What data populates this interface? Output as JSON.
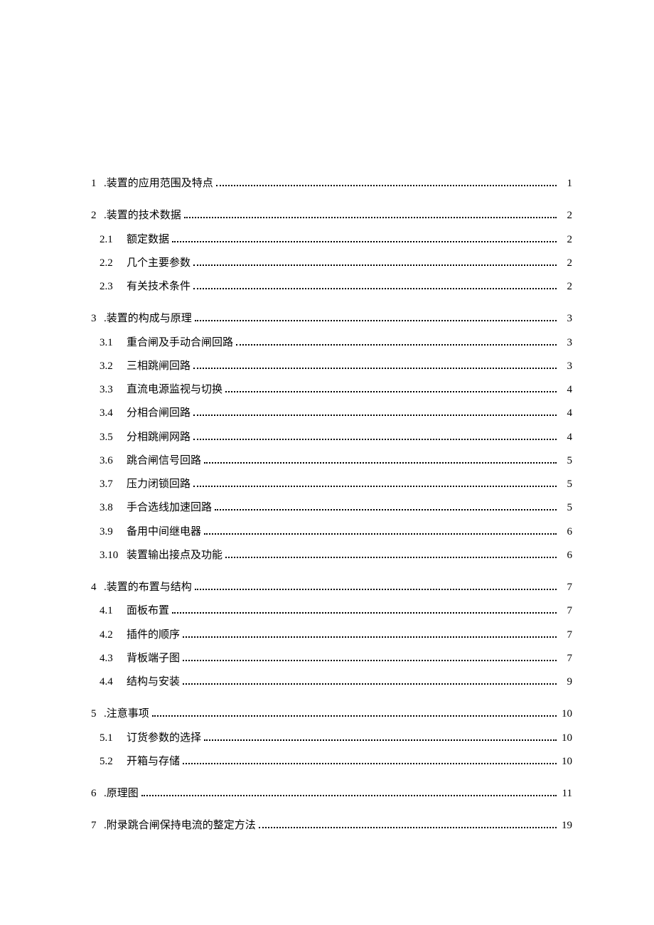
{
  "toc": {
    "sections": [
      {
        "num": "1",
        "title": ".装置的应用范围及特点",
        "page": "1",
        "children": []
      },
      {
        "num": "2",
        "title": ".装置的技术数据",
        "page": "2",
        "children": [
          {
            "num": "2.1",
            "title": "额定数据",
            "page": "2"
          },
          {
            "num": "2.2",
            "title": "几个主要参数",
            "page": "2"
          },
          {
            "num": "2.3",
            "title": "有关技术条件",
            "page": "2"
          }
        ]
      },
      {
        "num": "3",
        "title": ".装置的构成与原理",
        "page": "3",
        "children": [
          {
            "num": "3.1",
            "title": "重合闸及手动合闸回路",
            "page": "3"
          },
          {
            "num": "3.2",
            "title": "三相跳闸回路",
            "page": "3"
          },
          {
            "num": "3.3",
            "title": "直流电源监视与切换",
            "page": "4"
          },
          {
            "num": "3.4",
            "title": "分相合闸回路",
            "page": "4"
          },
          {
            "num": "3.5",
            "title": "分相跳闸网路",
            "page": "4"
          },
          {
            "num": "3.6",
            "title": "跳合闸信号回路",
            "page": "5"
          },
          {
            "num": "3.7",
            "title": "压力闭锁回路",
            "page": "5"
          },
          {
            "num": "3.8",
            "title": "手合选线加速回路",
            "page": "5"
          },
          {
            "num": "3.9",
            "title": "备用中间继电器",
            "page": "6"
          },
          {
            "num": "3.10",
            "title": "装置输出接点及功能",
            "page": "6"
          }
        ]
      },
      {
        "num": "4",
        "title": ".装置的布置与结构",
        "page": "7",
        "children": [
          {
            "num": "4.1",
            "title": "面板布置",
            "page": "7"
          },
          {
            "num": "4.2",
            "title": "插件的顺序",
            "page": "7"
          },
          {
            "num": "4.3",
            "title": "背板端子图",
            "page": "7"
          },
          {
            "num": "4.4",
            "title": "结构与安装",
            "page": "9"
          }
        ]
      },
      {
        "num": "5",
        "title": ".注意事项",
        "page": "10",
        "children": [
          {
            "num": "5.1",
            "title": "订货参数的选择",
            "page": "10"
          },
          {
            "num": "5.2",
            "title": "开箱与存储",
            "page": "10"
          }
        ]
      },
      {
        "num": "6",
        "title": ".原理图",
        "page": "11",
        "children": []
      },
      {
        "num": "7",
        "title": ".附录跳合闸保持电流的整定方法",
        "page": "19",
        "children": []
      }
    ]
  }
}
